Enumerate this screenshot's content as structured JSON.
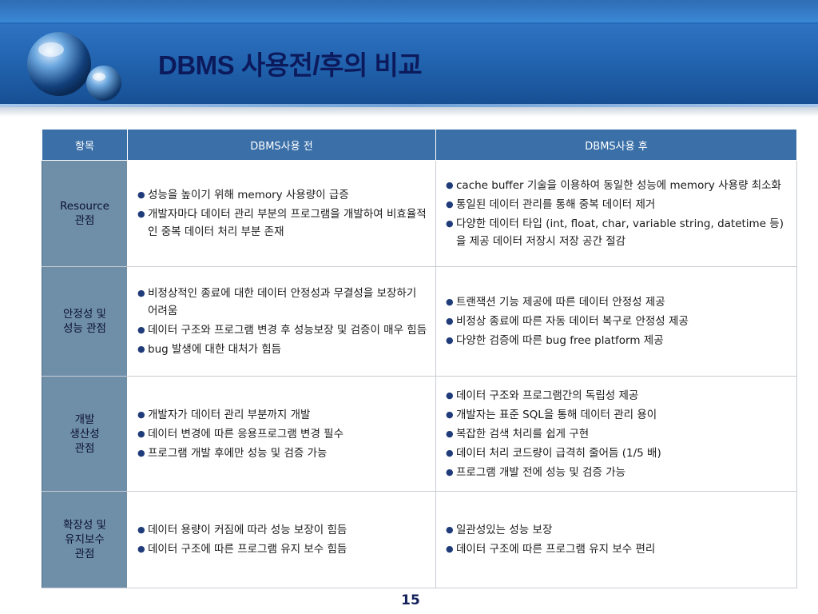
{
  "title": "DBMS 사용전/후의 비교",
  "page_number": "15",
  "colors": {
    "header_blue": "#2d7ccf",
    "table_header": "#3a6fa8",
    "category_cell": "#6f8fa9",
    "title_text": "#0c1a5c"
  },
  "table": {
    "headers": [
      "항목",
      "DBMS사용 전",
      "DBMS사용 후"
    ],
    "rows": [
      {
        "category": [
          "Resource",
          "관점"
        ],
        "before": [
          "성능을 높이기 위해 memory 사용량이 급증",
          "개발자마다 데이터 관리 부분의 프로그램을 개발하여 비효율적인 중복 데이터 처리 부분 존재"
        ],
        "after": [
          "cache buffer 기술을 이용하여 동일한 성능에 memory 사용량 최소화",
          "통일된 데이터 관리를 통해 중복 데이터 제거",
          "다양한 데이터 타입 (int, float, char, variable string, datetime 등)을 제공 데이터 저장시 저장 공간 절감"
        ]
      },
      {
        "category": [
          "안정성 및",
          "성능 관점"
        ],
        "before": [
          "비정상적인 종료에 대한 데이터 안정성과 무결성을 보장하기 어려움",
          "데이터 구조와 프로그램 변경 후 성능보장 및 검증이 매우 힘듬",
          "bug 발생에 대한 대처가 힘듬"
        ],
        "after": [
          "트랜잭션 기능 제공에 따른 데이터 안정성 제공",
          "비정상 종료에 따른 자동 데이터 복구로 안정성 제공",
          "다양한 검증에 따른 bug free platform 제공"
        ]
      },
      {
        "category": [
          "개발",
          "생산성",
          "관점"
        ],
        "before": [
          "개발자가 데이터 관리 부분까지 개발",
          "데이터 변경에 따른 응용프로그램 변경 필수",
          "프로그램 개발 후에만 성능 및 검증 가능"
        ],
        "after": [
          "데이터 구조와 프로그램간의 독립성 제공",
          "개발자는 표준 SQL을 통해 데이터 관리 용이",
          "복잡한 검색 처리를 쉽게 구현",
          "데이터 처리 코드량이 급격히 줄어듬 (1/5 배)",
          "프로그램 개발 전에 성능 및 검증 가능"
        ]
      },
      {
        "category": [
          "확장성 및",
          "유지보수",
          "관점"
        ],
        "before": [
          "데이터 용량이 커짐에 따라 성능 보장이 힘듬",
          "데이터 구조에 따른 프로그램 유지 보수 힘듬"
        ],
        "after": [
          "일관성있는 성능 보장",
          "데이터 구조에 따른 프로그램 유지 보수 편리"
        ]
      }
    ]
  }
}
